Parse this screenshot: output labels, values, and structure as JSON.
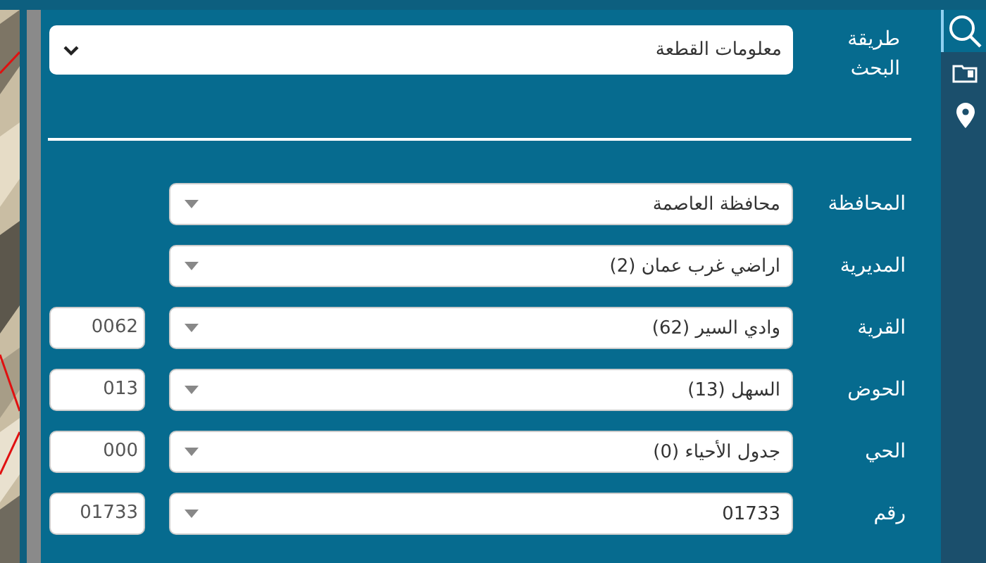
{
  "search_method": {
    "label": "طريقة البحث",
    "value": "معلومات القطعة"
  },
  "fields": [
    {
      "label": "المحافظة",
      "value": "محافظة العاصمة"
    },
    {
      "label": "المديرية",
      "value": "اراضي غرب عمان (2)"
    },
    {
      "label": "القرية",
      "value": "وادي السير (62)",
      "code": "0062"
    },
    {
      "label": "الحوض",
      "value": "السهل (13)",
      "code": "013"
    },
    {
      "label": "الحي",
      "value": "جدول الأحياء (0)",
      "code": "000"
    },
    {
      "label": "رقم",
      "value": "01733",
      "code": "01733"
    }
  ],
  "sidebar": {
    "items": [
      {
        "kind": "search",
        "selected": true
      },
      {
        "kind": "folder",
        "selected": false
      },
      {
        "kind": "pin",
        "selected": false
      }
    ]
  }
}
